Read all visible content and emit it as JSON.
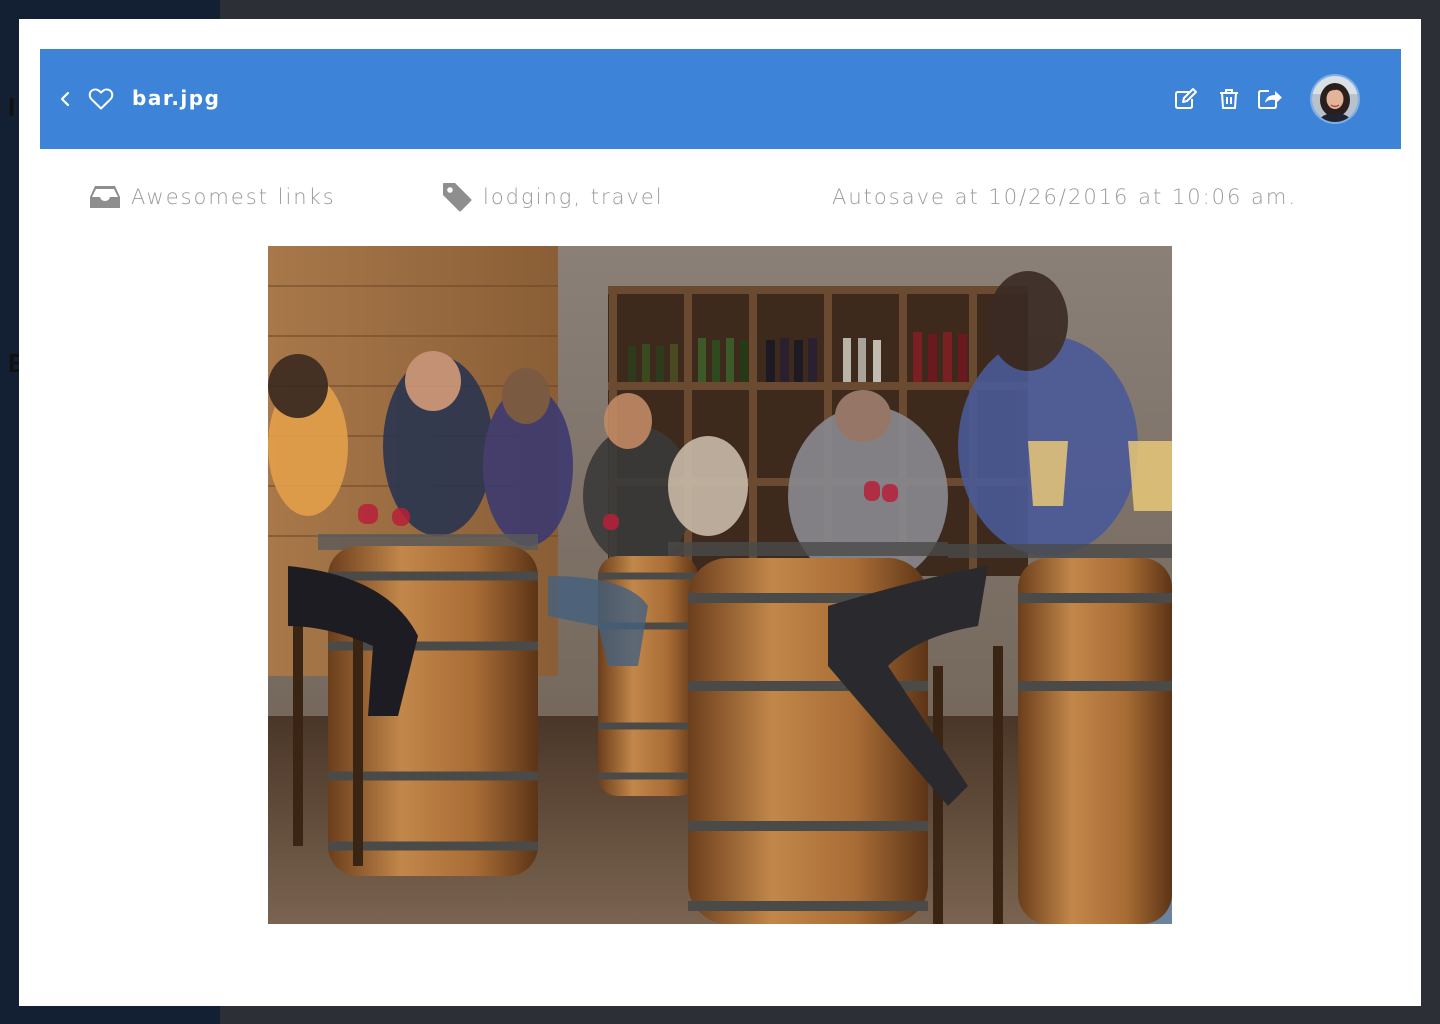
{
  "header": {
    "file_name": "bar.jpg",
    "back_icon": "chevron-left-icon",
    "favorite_icon": "heart-icon",
    "actions": [
      {
        "name": "edit",
        "icon": "edit-icon"
      },
      {
        "name": "delete",
        "icon": "trash-icon"
      },
      {
        "name": "share",
        "icon": "share-icon"
      }
    ],
    "color": "#3d84d9"
  },
  "meta": {
    "folder": "Awesomest links",
    "folder_icon": "inbox-icon",
    "tags": "lodging, travel",
    "tags_icon": "tag-icon",
    "autosave": "Autosave at 10/26/2016 at 10:06 am."
  },
  "background": {
    "fragments": [
      "I",
      "E"
    ]
  },
  "colors": {
    "header_bg": "#3d84d9",
    "meta_text": "#9a9a9a",
    "overlay": "#2a2d33"
  }
}
